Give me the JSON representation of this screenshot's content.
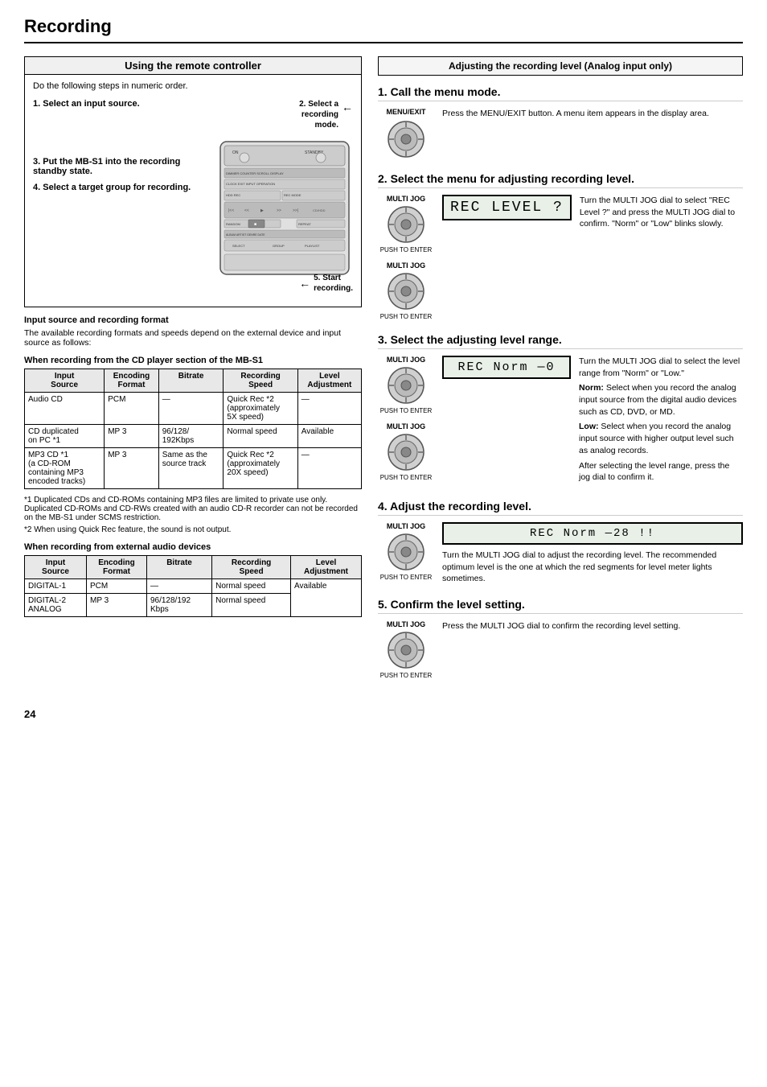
{
  "page": {
    "title": "Recording",
    "number": "24"
  },
  "left": {
    "section_title": "Using the remote controller",
    "intro": "Do the following steps in numeric order.",
    "steps": [
      {
        "num": "1.",
        "label": "Select an input source."
      },
      {
        "num": "3.",
        "label": "Put the MB-S1 into the recording standby state."
      },
      {
        "num": "4.",
        "label": "Select a target group for recording."
      },
      {
        "num": "2.",
        "label": "Select a recording mode.",
        "callout": true
      },
      {
        "num": "5.",
        "label": "Start recording.",
        "callout": true
      }
    ],
    "input_source_heading": "Input source and recording format",
    "input_source_text": "The available recording formats and speeds depend on the external device and input source as follows:",
    "table1_heading": "When recording from the CD player section of the MB-S1",
    "table1_headers": [
      "Input Source",
      "Encoding Format",
      "Bitrate",
      "Recording Speed",
      "Level Adjustment"
    ],
    "table1_rows": [
      [
        "Audio CD",
        "PCM",
        "—",
        "Quick Rec *2\n(approximately\n5X speed)",
        "—"
      ],
      [
        "CD duplicated\non PC *1",
        "MP 3",
        "96/128/\n192Kbps",
        "Normal speed",
        "Available"
      ],
      [
        "MP3 CD *1\n(a CD-ROM\ncontaining MP3\nencoded tracks)",
        "MP 3",
        "Same as the\nsource track",
        "Quick Rec *2\n(approximately\n20X speed)",
        "—"
      ]
    ],
    "footnote1": "*1 Duplicated CDs and CD-ROMs containing MP3 files are limited to private use only. Duplicated CD-ROMs and CD-RWs created with an audio CD-R recorder can not be recorded on the MB-S1 under SCMS restriction.",
    "footnote2": "*2 When using Quick Rec feature, the sound is not output.",
    "table2_heading": "When recording from external audio devices",
    "table2_headers": [
      "Input Source",
      "Encoding Format",
      "Bitrate",
      "Recording Speed",
      "Level Adjustment"
    ],
    "table2_rows": [
      [
        "DIGITAL-1",
        "PCM",
        "—",
        "Normal speed",
        ""
      ],
      [
        "DIGITAL-2\nANALOG",
        "MP 3",
        "96/128/192\nKbps",
        "Normal speed",
        "Available"
      ]
    ]
  },
  "right": {
    "section_title": "Adjusting the recording level (Analog input only)",
    "steps": [
      {
        "num": "1.",
        "title": "Call the menu mode.",
        "icon_label": "MENU/EXIT",
        "text": "Press the MENU/EXIT button. A menu item appears in the display area."
      },
      {
        "num": "2.",
        "title": "Select the menu for adjusting recording level.",
        "jog_label": "MULTI JOG",
        "display": "REC LEVEL ?",
        "text": "Turn the MULTI JOG dial to select \"REC Level ?\" and press the MULTI JOG dial to confirm. \"Norm\" or \"Low\" blinks slowly.",
        "push_label": "PUSH TO ENTER",
        "has_second_jog": true
      },
      {
        "num": "3.",
        "title": "Select the adjusting level range.",
        "jog_label": "MULTI JOG",
        "display": "REC Norm  —0",
        "text": "Turn the MULTI JOG dial to select the level range from \"Norm\" or \"Low.\"",
        "norm_text": "Norm: Select when you record the analog input source from the digital audio devices such as CD, DVD, or MD.",
        "low_text": "Low: Select when you record the analog input source with higher output level such as analog records.",
        "after_text": "After selecting the level range, press the jog dial to confirm it.",
        "push_label": "PUSH TO ENTER",
        "has_second_jog": true
      },
      {
        "num": "4.",
        "title": "Adjust the recording level.",
        "jog_label": "MULTI JOG",
        "display": "REC Norm  —28 !!",
        "text": "Turn the MULTI JOG dial to adjust the recording level. The recommended optimum level is the one at which the red segments for level meter lights sometimes.",
        "push_label": "PUSH TO ENTER"
      },
      {
        "num": "5.",
        "title": "Confirm the level setting.",
        "jog_label": "MULTI JOG",
        "text": "Press the MULTI JOG dial to confirm the recording level setting.",
        "push_label": "PUSH TO ENTER"
      }
    ]
  }
}
